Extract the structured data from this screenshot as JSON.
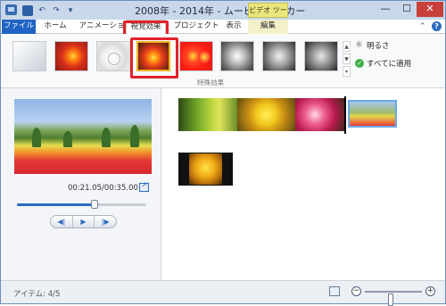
{
  "window": {
    "title": "2008年 - 2014年 - ムービー メーカー",
    "contextual_tab_group": "ビデオ ツール",
    "minimize_glyph": "—",
    "maximize_glyph": "☐",
    "close_glyph": "✕"
  },
  "quick_access": {
    "undo_glyph": "↶",
    "redo_glyph": "↷",
    "dropdown_glyph": "▾"
  },
  "tabs": [
    {
      "id": "file",
      "label": "ファイル",
      "active": false
    },
    {
      "id": "home",
      "label": "ホーム",
      "active": false
    },
    {
      "id": "animation",
      "label": "アニメーション",
      "active": false
    },
    {
      "id": "visual",
      "label": "視覚効果",
      "active": true
    },
    {
      "id": "project",
      "label": "プロジェクト",
      "active": false
    },
    {
      "id": "view",
      "label": "表示",
      "active": false
    },
    {
      "id": "edit",
      "label": "編集",
      "active": false
    }
  ],
  "ribbon": {
    "effects": [
      {
        "name": "no-effect"
      },
      {
        "name": "warm"
      },
      {
        "name": "white-blur"
      },
      {
        "name": "selected-warm-strong",
        "selected": true
      },
      {
        "name": "red-pop"
      },
      {
        "name": "grayscale-light"
      },
      {
        "name": "grayscale-medium"
      },
      {
        "name": "grayscale-dark"
      }
    ],
    "scroll_up": "▲",
    "scroll_down": "▼",
    "scroll_more": "▾",
    "brightness_label": "明るさ",
    "apply_all_label": "すべてに適用",
    "group_label": "特殊効果",
    "help_glyph": "?"
  },
  "preview": {
    "time": "00:21.05/00:35.00",
    "seek_progress": 0.6,
    "controls": {
      "prev_frame": "◀|",
      "play": "▶",
      "next_frame": "|▶"
    }
  },
  "status": {
    "item_count": "アイテム: 4/5",
    "zoom_level": 0.45
  },
  "colors": {
    "file_tab": "#1f64c4",
    "highlight_box": "#e2212b",
    "contextual_group": "#e8e67c"
  }
}
